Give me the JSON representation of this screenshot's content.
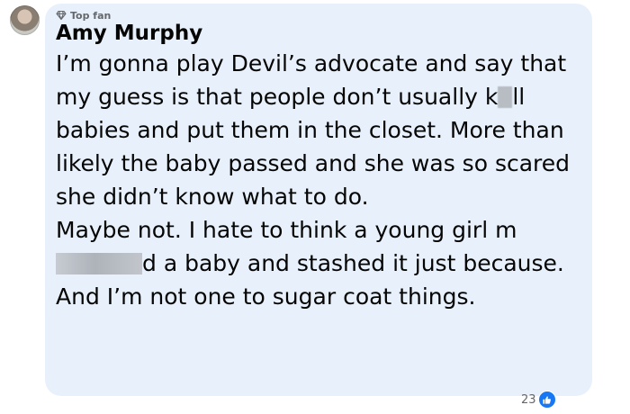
{
  "comment": {
    "badge_label": "Top fan",
    "badge_icon": "diamond-icon",
    "author": "Amy Murphy",
    "paragraph1_a": "I’m gonna play Devil’s advocate and say that my guess is that people don’t usually k",
    "paragraph1_b": "ll babies and put them in the closet. More than likely the baby passed and she was so scared she didn’t know what to do.",
    "paragraph2_a": "Maybe not. I hate to think a young girl m",
    "paragraph2_b": "d a baby and stashed it just because. And I’m not one to sugar coat things.",
    "reaction_count": "23",
    "reaction_icon": "like-icon",
    "like_color": "#1877f2",
    "bubble_color": "#e8f1fb"
  }
}
